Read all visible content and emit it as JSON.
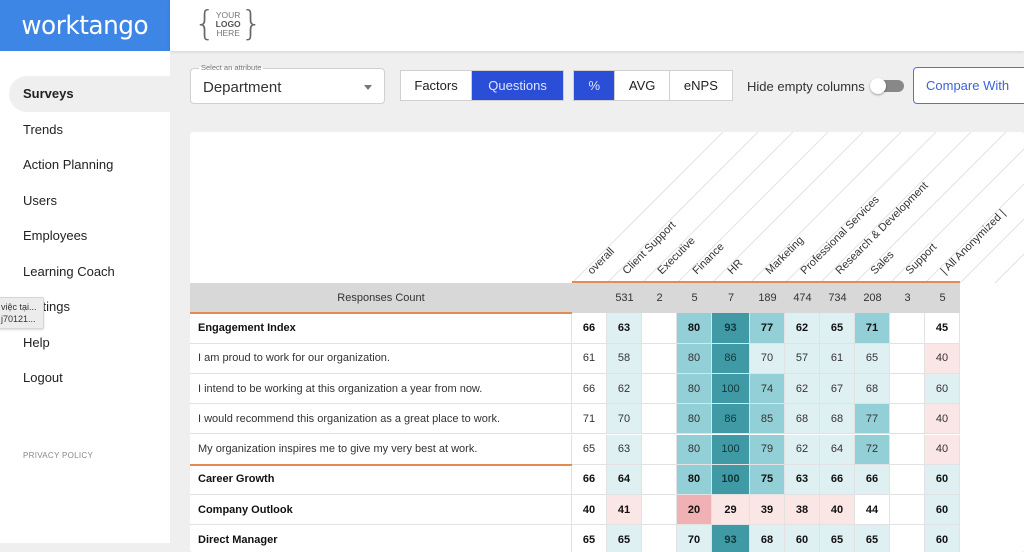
{
  "brand": "worktango",
  "logo": {
    "line1": "YOUR",
    "line2": "LOGO",
    "line3": "HERE"
  },
  "sidebar": {
    "items": [
      {
        "label": "Surveys",
        "active": true
      },
      {
        "label": "Trends"
      },
      {
        "label": "Action Planning"
      },
      {
        "label": "Users"
      },
      {
        "label": "Employees"
      },
      {
        "label": "Learning Coach"
      },
      {
        "label": "Settings"
      },
      {
        "label": "Help"
      },
      {
        "label": "Logout"
      }
    ],
    "privacy": "PRIVACY POLICY"
  },
  "tooltip": {
    "line1": "việc tại...",
    "line2": "j70121..."
  },
  "toolbar": {
    "attribute_label": "Select an attribute",
    "attribute_value": "Department",
    "view_tabs": [
      {
        "label": "Factors",
        "active": false
      },
      {
        "label": "Questions",
        "active": true
      }
    ],
    "metric_tabs": [
      {
        "label": "%",
        "active": true
      },
      {
        "label": "AVG",
        "active": false
      },
      {
        "label": "eNPS",
        "active": false
      }
    ],
    "hide_empty_label": "Hide empty columns",
    "hide_empty_on": false,
    "compare_label": "Compare With"
  },
  "colors": {
    "primary": "#2a4ed6",
    "brand": "#3d86e6",
    "accent_orange": "#e58a52",
    "teal_dark": "#3f9aa5",
    "teal_mid": "#93cfd6",
    "teal_light": "#dff0f3",
    "pink_light": "#fbe6e6",
    "pink_mid": "#f0b1b4"
  },
  "table": {
    "columns": [
      "overall",
      "Client Support",
      "Executive",
      "Finance",
      "HR",
      "Marketing",
      "Professional Services",
      "Research & Development",
      "Sales",
      "Support",
      "| All Anonymized |"
    ],
    "responses_label": "Responses Count",
    "responses": [
      "",
      "531",
      "2",
      "5",
      "7",
      "189",
      "474",
      "734",
      "208",
      "3",
      "5"
    ],
    "rows": [
      {
        "label": "Engagement Index",
        "bold": true,
        "values": [
          "66",
          "63",
          "",
          "80",
          "93",
          "77",
          "62",
          "65",
          "71",
          "",
          "45"
        ],
        "shade": [
          "w",
          "l",
          "w",
          "m",
          "d",
          "m",
          "l",
          "l",
          "m",
          "w",
          "w"
        ]
      },
      {
        "label": "I am proud to work for our organization.",
        "bold": false,
        "values": [
          "61",
          "58",
          "",
          "80",
          "86",
          "70",
          "57",
          "61",
          "65",
          "",
          "40"
        ],
        "shade": [
          "w",
          "l",
          "w",
          "m",
          "d",
          "l",
          "l",
          "l",
          "l",
          "w",
          "p"
        ]
      },
      {
        "label": "I intend to be working at this organization a year from now.",
        "bold": false,
        "values": [
          "66",
          "62",
          "",
          "80",
          "100",
          "74",
          "62",
          "67",
          "68",
          "",
          "60"
        ],
        "shade": [
          "w",
          "l",
          "w",
          "m",
          "d",
          "m",
          "l",
          "l",
          "l",
          "w",
          "l"
        ]
      },
      {
        "label": "I would recommend this organization as a great place to work.",
        "bold": false,
        "values": [
          "71",
          "70",
          "",
          "80",
          "86",
          "85",
          "68",
          "68",
          "77",
          "",
          "40"
        ],
        "shade": [
          "w",
          "l",
          "w",
          "m",
          "d",
          "m",
          "l",
          "l",
          "m",
          "w",
          "p"
        ]
      },
      {
        "label": "My organization inspires me to give my very best at work.",
        "bold": false,
        "values": [
          "65",
          "63",
          "",
          "80",
          "100",
          "79",
          "62",
          "64",
          "72",
          "",
          "40"
        ],
        "shade": [
          "w",
          "l",
          "w",
          "m",
          "d",
          "m",
          "l",
          "l",
          "m",
          "w",
          "p"
        ]
      },
      {
        "label": "Career Growth",
        "bold": true,
        "values": [
          "66",
          "64",
          "",
          "80",
          "100",
          "75",
          "63",
          "66",
          "66",
          "",
          "60"
        ],
        "shade": [
          "w",
          "l",
          "w",
          "m",
          "d",
          "m",
          "l",
          "l",
          "l",
          "w",
          "l"
        ]
      },
      {
        "label": "Company Outlook",
        "bold": true,
        "values": [
          "40",
          "41",
          "",
          "20",
          "29",
          "39",
          "38",
          "40",
          "44",
          "",
          "60"
        ],
        "shade": [
          "w",
          "p",
          "w",
          "q",
          "p",
          "p",
          "p",
          "p",
          "w",
          "w",
          "l"
        ]
      },
      {
        "label": "Direct Manager",
        "bold": true,
        "values": [
          "65",
          "65",
          "",
          "70",
          "93",
          "68",
          "60",
          "65",
          "65",
          "",
          "60"
        ],
        "shade": [
          "w",
          "l",
          "w",
          "l",
          "d",
          "l",
          "l",
          "l",
          "l",
          "w",
          "l"
        ]
      }
    ]
  }
}
